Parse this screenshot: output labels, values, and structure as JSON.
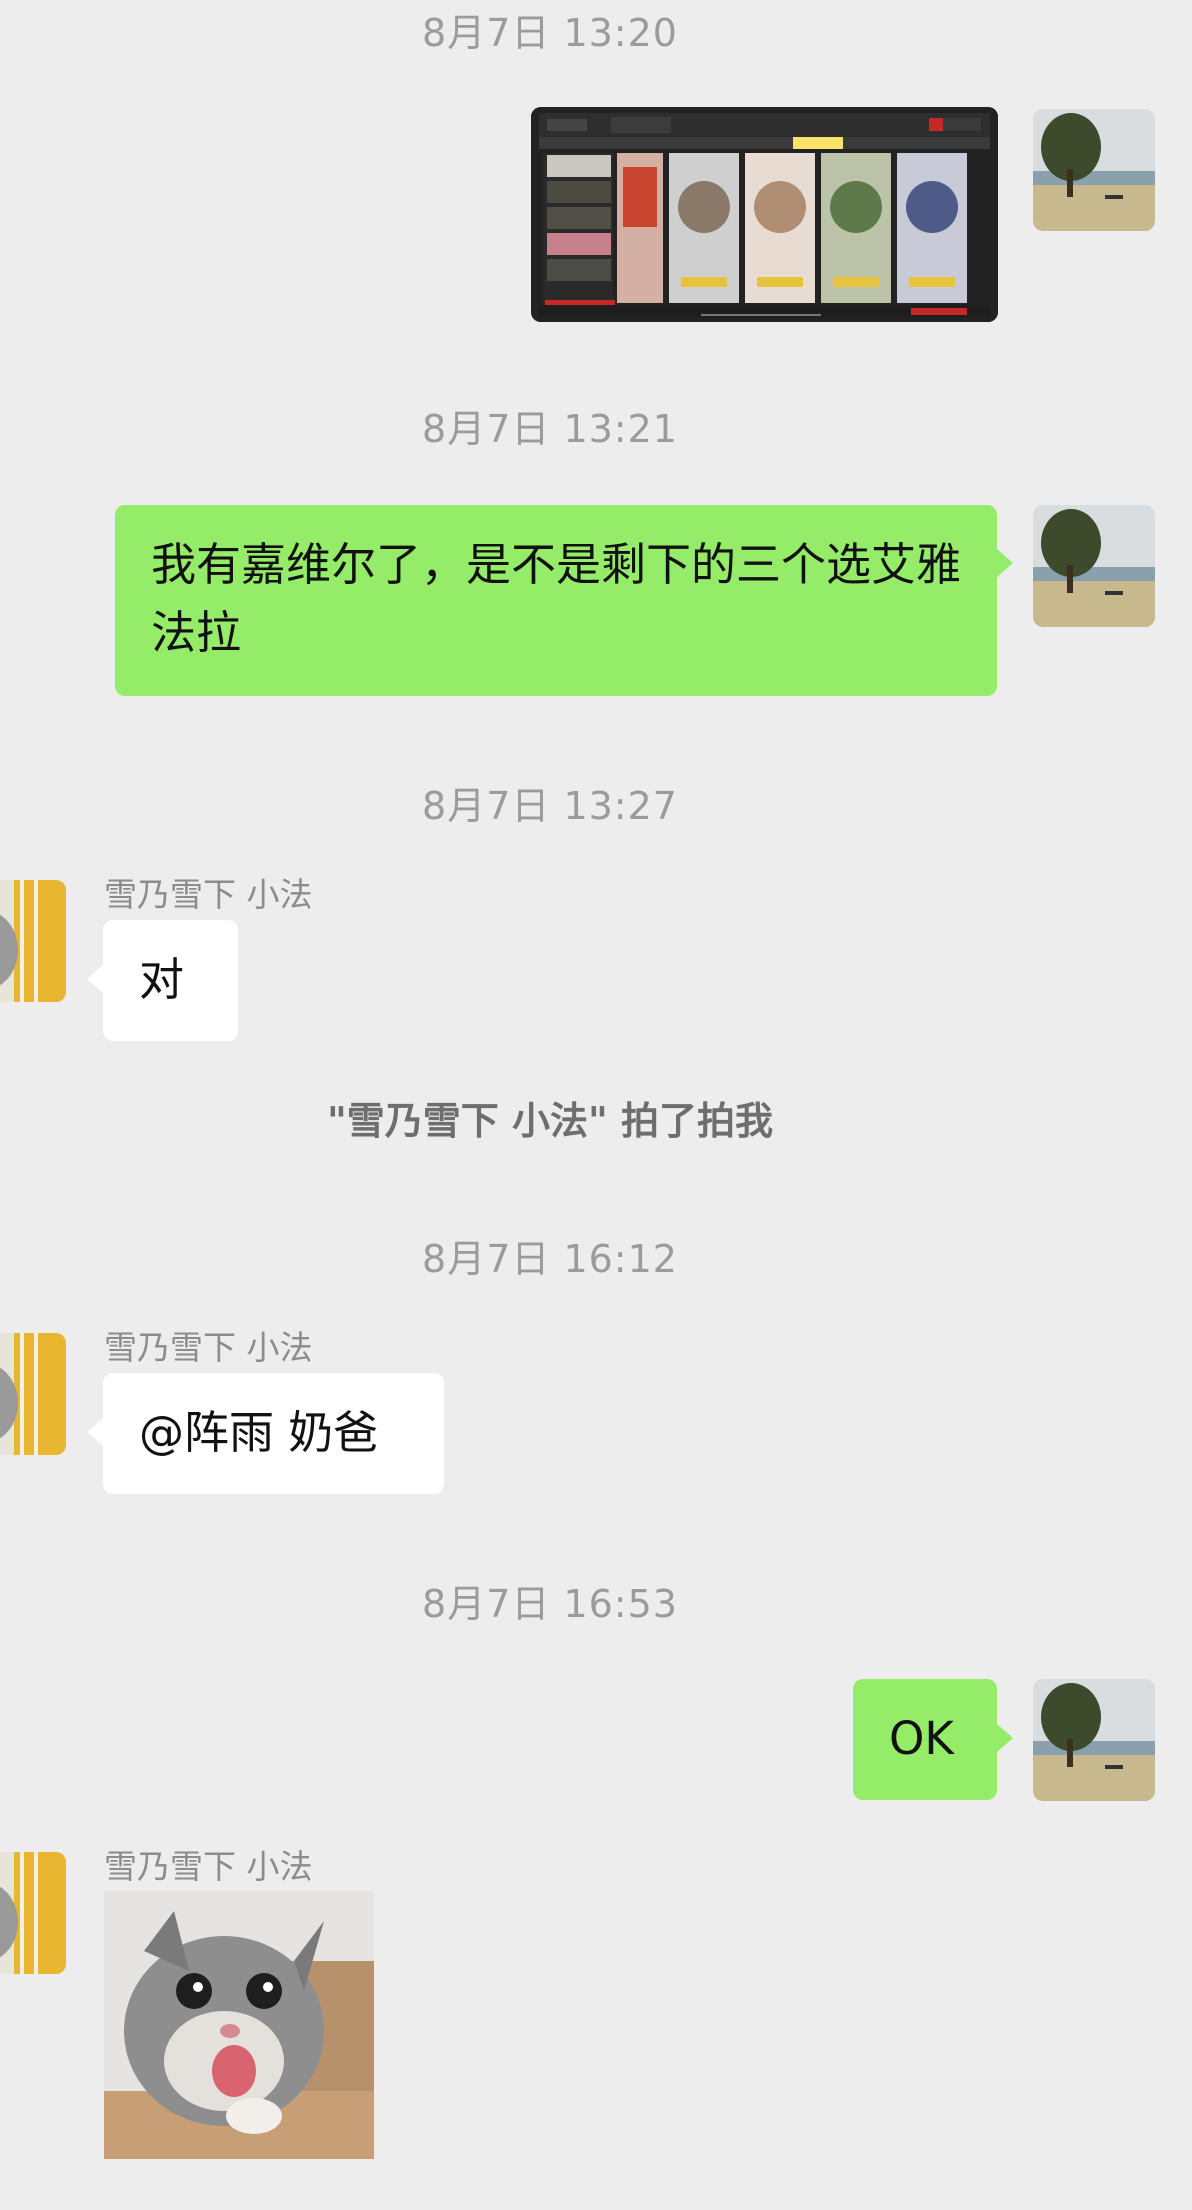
{
  "timestamps": [
    "8月7日 13:20",
    "8月7日 13:21",
    "8月7日 13:27",
    "8月7日 16:12",
    "8月7日 16:53"
  ],
  "contact_name": "雪乃雪下  小法",
  "messages": {
    "m2": "我有嘉维尔了，是不是剩下的三个选艾雅法拉",
    "m3": "对",
    "m5": "@阵雨 奶爸",
    "m6": "OK"
  },
  "pat_notice": "\"雪乃雪下  小法\" 拍了拍我",
  "colors": {
    "background": "#ededed",
    "self_bubble": "#95ec69",
    "other_bubble": "#ffffff",
    "timestamp": "#9b9b9b"
  }
}
